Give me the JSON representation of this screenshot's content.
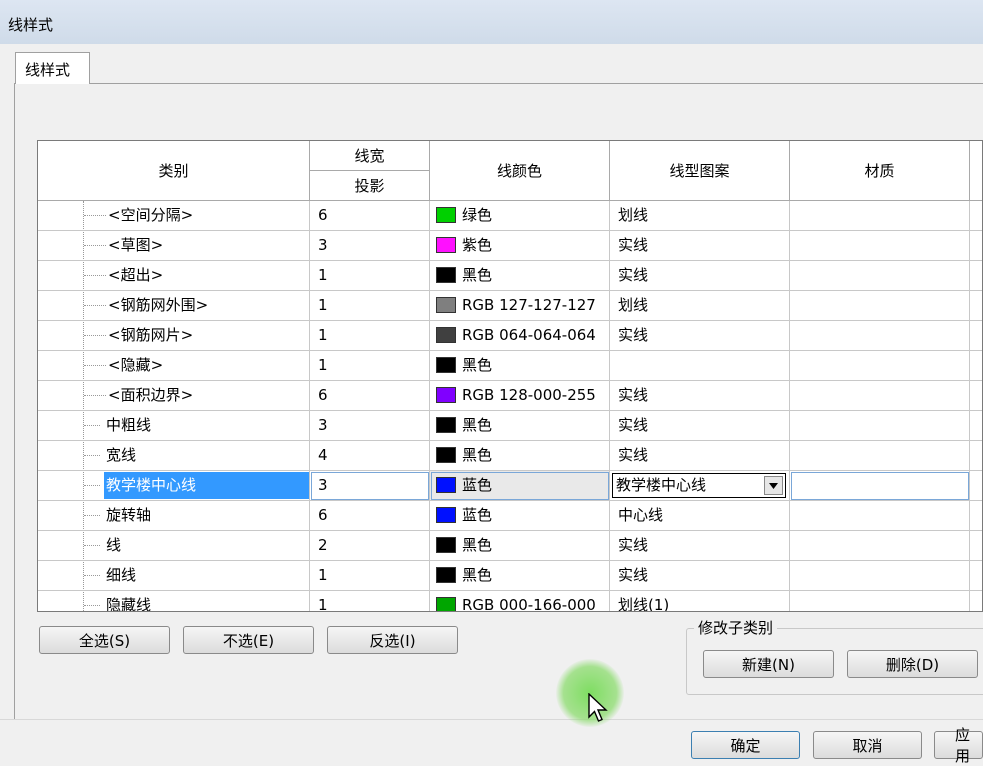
{
  "window": {
    "title": "线样式"
  },
  "tab": {
    "label": "线样式"
  },
  "table": {
    "headers": {
      "category": "类别",
      "line_weight": "线宽",
      "projection": "投影",
      "line_color": "线颜色",
      "line_pattern": "线型图案",
      "material": "材质"
    },
    "rows": [
      {
        "name": "<空间分隔>",
        "weight": "6",
        "color_name": "绿色",
        "color_hex": "#00d000",
        "pattern": "划线",
        "indent": 2
      },
      {
        "name": "<草图>",
        "weight": "3",
        "color_name": "紫色",
        "color_hex": "#ff10ff",
        "pattern": "实线",
        "indent": 2
      },
      {
        "name": "<超出>",
        "weight": "1",
        "color_name": "黑色",
        "color_hex": "#000000",
        "pattern": "实线",
        "indent": 2
      },
      {
        "name": "<钢筋网外围>",
        "weight": "1",
        "color_name": "RGB 127-127-127",
        "color_hex": "#7f7f7f",
        "pattern": "划线",
        "indent": 2
      },
      {
        "name": "<钢筋网片>",
        "weight": "1",
        "color_name": "RGB 064-064-064",
        "color_hex": "#404040",
        "pattern": "实线",
        "indent": 2
      },
      {
        "name": "<隐藏>",
        "weight": "1",
        "color_name": "黑色",
        "color_hex": "#000000",
        "pattern": "",
        "indent": 2
      },
      {
        "name": "<面积边界>",
        "weight": "6",
        "color_name": "RGB 128-000-255",
        "color_hex": "#8000ff",
        "pattern": "实线",
        "indent": 2
      },
      {
        "name": "中粗线",
        "weight": "3",
        "color_name": "黑色",
        "color_hex": "#000000",
        "pattern": "实线",
        "indent": 1
      },
      {
        "name": "宽线",
        "weight": "4",
        "color_name": "黑色",
        "color_hex": "#000000",
        "pattern": "实线",
        "indent": 1
      },
      {
        "name": "教学楼中心线",
        "weight": "3",
        "color_name": "蓝色",
        "color_hex": "#0010ff",
        "pattern": "教学楼中心线",
        "indent": 1,
        "selected": true
      },
      {
        "name": "旋转轴",
        "weight": "6",
        "color_name": "蓝色",
        "color_hex": "#0010ff",
        "pattern": "中心线",
        "indent": 1
      },
      {
        "name": "线",
        "weight": "2",
        "color_name": "黑色",
        "color_hex": "#000000",
        "pattern": "实线",
        "indent": 1
      },
      {
        "name": "细线",
        "weight": "1",
        "color_name": "黑色",
        "color_hex": "#000000",
        "pattern": "实线",
        "indent": 1
      },
      {
        "name": "隐藏线",
        "weight": "1",
        "color_name": "RGB 000-166-000",
        "color_hex": "#00a600",
        "pattern": "划线(1)",
        "indent": 1
      }
    ]
  },
  "buttons": {
    "select_all": "全选(S)",
    "select_none": "不选(E)",
    "invert": "反选(I)",
    "new": "新建(N)",
    "delete": "删除(D)",
    "ok": "确定",
    "cancel": "取消",
    "apply": "应用"
  },
  "group": {
    "label": "修改子类别"
  }
}
